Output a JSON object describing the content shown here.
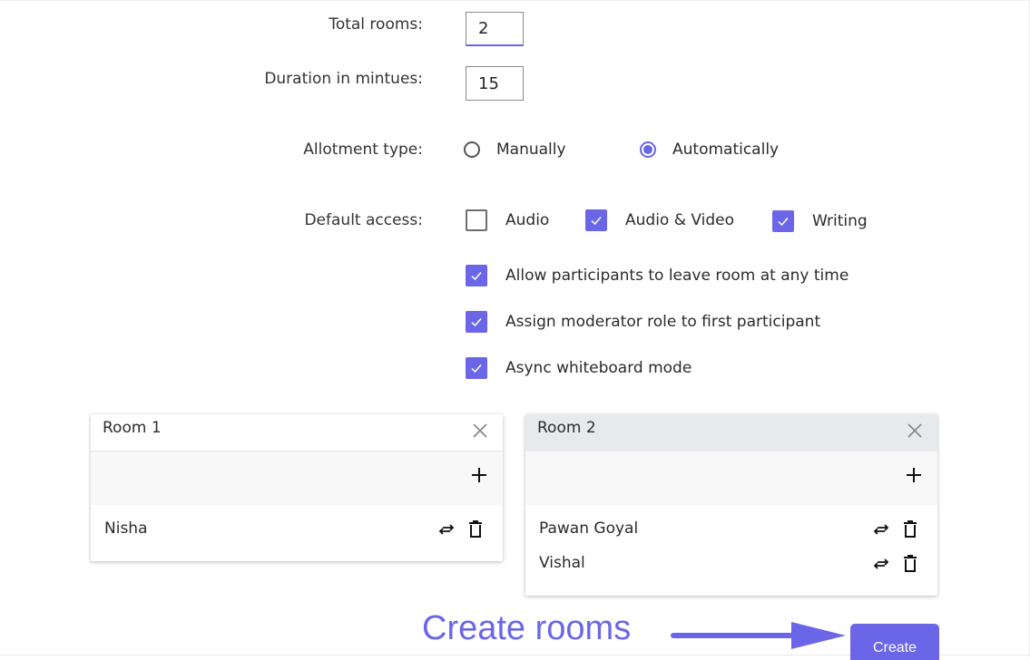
{
  "form": {
    "total_rooms": {
      "label": "Total rooms:",
      "value": "2"
    },
    "duration": {
      "label": "Duration in mintues:",
      "value": "15"
    },
    "allotment": {
      "label": "Allotment type:",
      "options": [
        {
          "label": "Manually",
          "selected": false
        },
        {
          "label": "Automatically",
          "selected": true
        }
      ]
    },
    "default_access": {
      "label": "Default access:",
      "options": [
        {
          "label": "Audio",
          "checked": false
        },
        {
          "label": "Audio & Video",
          "checked": true
        },
        {
          "label": "Writing",
          "checked": true
        }
      ]
    },
    "extra_options": [
      {
        "label": "Allow participants to leave room at any time",
        "checked": true
      },
      {
        "label": "Assign moderator role to first participant",
        "checked": true
      },
      {
        "label": "Async whiteboard mode",
        "checked": true
      }
    ]
  },
  "rooms": [
    {
      "title": "Room 1",
      "active": false,
      "participants": [
        "Nisha"
      ]
    },
    {
      "title": "Room 2",
      "active": true,
      "participants": [
        "Pawan Goyal",
        "Vishal"
      ]
    }
  ],
  "annotation": {
    "text": "Create rooms"
  },
  "create_button": {
    "label": "Create"
  },
  "colors": {
    "accent": "#6b66e8"
  },
  "icons": {
    "close": "close-icon",
    "add": "plus-icon",
    "move": "swap-arrows-icon",
    "delete": "trash-icon",
    "check": "checkmark-icon"
  }
}
